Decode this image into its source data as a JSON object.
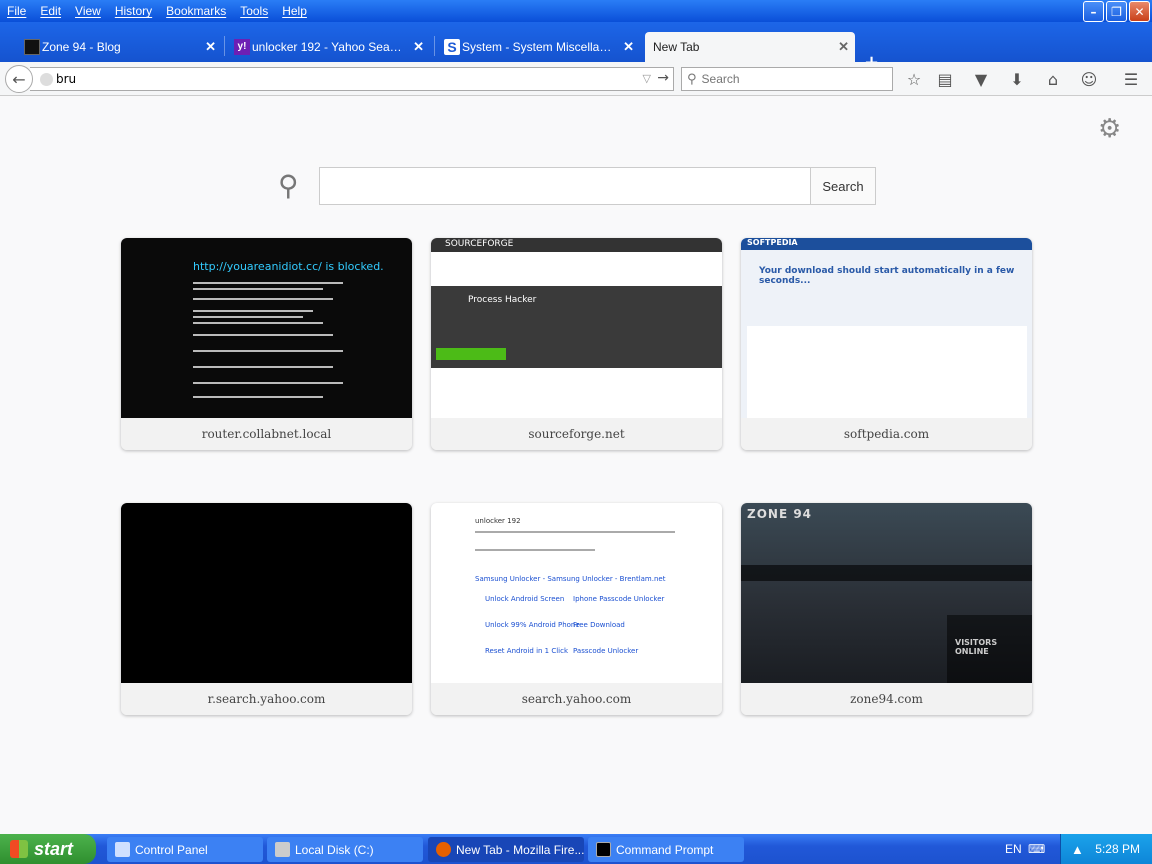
{
  "menubar": {
    "items": [
      "File",
      "Edit",
      "View",
      "History",
      "Bookmarks",
      "Tools",
      "Help"
    ]
  },
  "window": {
    "minimize_icon": "minimize-icon",
    "restore_icon": "restore-icon",
    "close_icon": "close-icon"
  },
  "tabs": [
    {
      "title": "Zone 94 - Blog",
      "icon": "zone94-favicon"
    },
    {
      "title": "unlocker 192 - Yahoo Search ...",
      "icon": "yahoo-favicon"
    },
    {
      "title": "System - System Miscellaneou...",
      "icon": "softpedia-favicon"
    },
    {
      "title": "New Tab",
      "icon": "none",
      "active": true
    }
  ],
  "navbar": {
    "url_value": "bru",
    "search_placeholder": "Search"
  },
  "content": {
    "search_button": "Search",
    "tiles": [
      {
        "label": "router.collabnet.local",
        "thumb_text": "http://youareanidiot.cc/ is blocked."
      },
      {
        "label": "sourceforge.net",
        "thumb_text": "SOURCEFORGE",
        "thumb_sub": "Process Hacker"
      },
      {
        "label": "softpedia.com",
        "thumb_text": "SOFTPEDIA",
        "thumb_sub": "Your download should start automatically in a few seconds..."
      },
      {
        "label": "r.search.yahoo.com"
      },
      {
        "label": "search.yahoo.com",
        "thumb_text": "unlocker 192",
        "links": [
          "Samsung Unlocker - Samsung Unlocker - Brentlam.net",
          "Unlock Android Screen",
          "Iphone Passcode Unlocker",
          "Unlock 99% Android Phone",
          "Free Download",
          "Reset Android in 1 Click",
          "Passcode Unlocker"
        ]
      },
      {
        "label": "zone94.com",
        "thumb_text": "ZONE 94",
        "thumb_sub": "VISITORS ONLINE"
      }
    ]
  },
  "taskbar": {
    "start_label": "start",
    "items": [
      {
        "label": "Control Panel",
        "active": false
      },
      {
        "label": "Local Disk (C:)",
        "active": false
      },
      {
        "label": "New Tab - Mozilla Fire...",
        "active": true
      },
      {
        "label": "Command Prompt",
        "active": false
      }
    ],
    "lang": "EN",
    "clock": "5:28 PM"
  },
  "colors": {
    "xp_blue": "#1553cf",
    "tab_active_bg": "#f5f6f7",
    "start_green": "#2f8f2f"
  }
}
